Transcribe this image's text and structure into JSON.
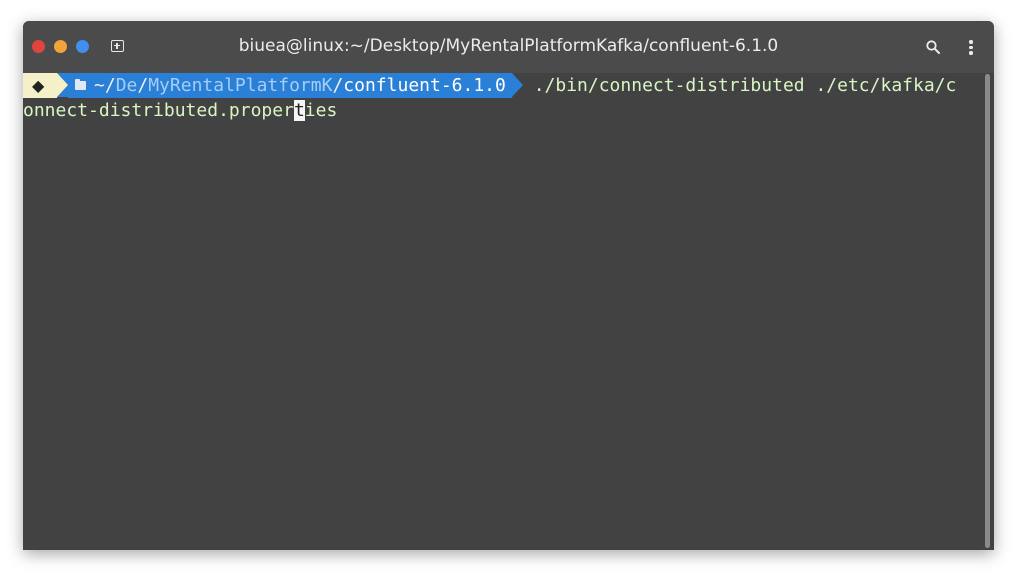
{
  "window": {
    "title": "biuea@linux:~/Desktop/MyRentalPlatformKafka/confluent-6.1.0",
    "traffic_lights": {
      "close_color": "#e0443e",
      "minimize_color": "#f2a33a",
      "maximize_color": "#3f8ef0"
    },
    "icons": {
      "new_tab": "new-tab-icon",
      "search": "search-icon",
      "menu": "kebab-menu-icon"
    }
  },
  "prompt": {
    "os_glyph": "◆",
    "folder_icon": "folder-icon",
    "path_home": "~/",
    "path_seg1": "De",
    "path_sep1": "/",
    "path_seg2": "MyRentalPlatformK",
    "path_sep2": "/",
    "path_current": "confluent-6.1.0",
    "colors": {
      "os_segment_bg": "#f5f0c8",
      "path_segment_bg": "#2a7fd6",
      "command_text": "#d8f5c4"
    }
  },
  "command": {
    "line1": " ./bin/connect-distributed ./etc/kafka/c",
    "line2_before_cursor": "onnect-distributed.proper",
    "cursor_char": "t",
    "line2_after_cursor": "ies"
  }
}
